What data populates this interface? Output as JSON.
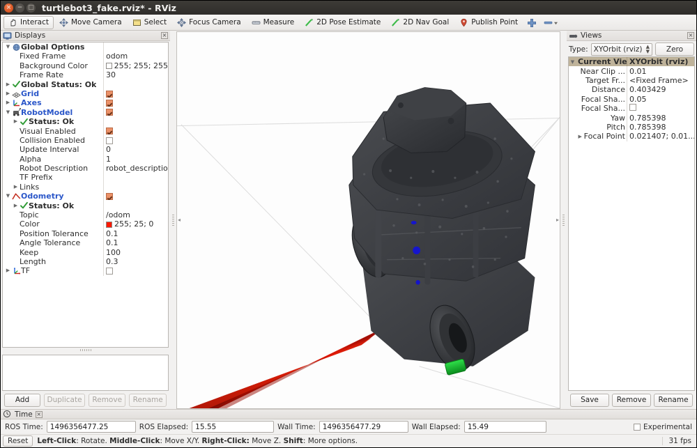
{
  "window": {
    "title": "turtlebot3_fake.rviz* - RViz",
    "buttons": {
      "close": "×",
      "minimize": "−",
      "maximize": "□"
    }
  },
  "toolbar": {
    "items": [
      {
        "label": "Interact",
        "icon": "hand-icon",
        "active": true
      },
      {
        "label": "Move Camera",
        "icon": "move-camera-icon",
        "active": false
      },
      {
        "label": "Select",
        "icon": "select-rect-icon",
        "active": false
      },
      {
        "label": "Focus Camera",
        "icon": "focus-camera-icon",
        "active": false
      },
      {
        "label": "Measure",
        "icon": "measure-icon",
        "active": false
      },
      {
        "label": "2D Pose Estimate",
        "icon": "pose-arrow-icon",
        "active": false
      },
      {
        "label": "2D Nav Goal",
        "icon": "nav-goal-icon",
        "active": false
      },
      {
        "label": "Publish Point",
        "icon": "map-pin-icon",
        "active": false
      }
    ],
    "add_tool_icon": "plus-icon",
    "remove_tool_icon": "minus-dropdown-icon"
  },
  "displays": {
    "panel_title": "Displays",
    "panel_icon": "monitor-icon",
    "close_label": "×",
    "rows": [
      {
        "indent": 0,
        "arrow": "open",
        "icon": "globe-icon",
        "label": "Global Options",
        "style": "bold",
        "value": "",
        "value_type": "text"
      },
      {
        "indent": 1,
        "arrow": "none",
        "icon": "none",
        "label": "Fixed Frame",
        "style": "plain",
        "value": "odom",
        "value_type": "text"
      },
      {
        "indent": 1,
        "arrow": "none",
        "icon": "none",
        "label": "Background Color",
        "style": "plain",
        "value": "255; 255; 255",
        "value_type": "color",
        "color": "#ffffff"
      },
      {
        "indent": 1,
        "arrow": "none",
        "icon": "none",
        "label": "Frame Rate",
        "style": "plain",
        "value": "30",
        "value_type": "text"
      },
      {
        "indent": 0,
        "arrow": "closed",
        "icon": "check-icon",
        "label": "Global Status: Ok",
        "style": "bold",
        "value": "",
        "value_type": "text"
      },
      {
        "indent": 0,
        "arrow": "closed",
        "icon": "grid-icon",
        "label": "Grid",
        "style": "blue",
        "value": "",
        "value_type": "checkbox",
        "checked": true
      },
      {
        "indent": 0,
        "arrow": "closed",
        "icon": "axes-icon",
        "label": "Axes",
        "style": "blue",
        "value": "",
        "value_type": "checkbox",
        "checked": true
      },
      {
        "indent": 0,
        "arrow": "open",
        "icon": "robot-icon",
        "label": "RobotModel",
        "style": "blue",
        "value": "",
        "value_type": "checkbox",
        "checked": true
      },
      {
        "indent": 1,
        "arrow": "closed",
        "icon": "check-icon",
        "label": "Status: Ok",
        "style": "bold",
        "value": "",
        "value_type": "text"
      },
      {
        "indent": 1,
        "arrow": "none",
        "icon": "none",
        "label": "Visual Enabled",
        "style": "plain",
        "value": "",
        "value_type": "checkbox",
        "checked": true
      },
      {
        "indent": 1,
        "arrow": "none",
        "icon": "none",
        "label": "Collision Enabled",
        "style": "plain",
        "value": "",
        "value_type": "checkbox",
        "checked": false
      },
      {
        "indent": 1,
        "arrow": "none",
        "icon": "none",
        "label": "Update Interval",
        "style": "plain",
        "value": "0",
        "value_type": "text"
      },
      {
        "indent": 1,
        "arrow": "none",
        "icon": "none",
        "label": "Alpha",
        "style": "plain",
        "value": "1",
        "value_type": "text"
      },
      {
        "indent": 1,
        "arrow": "none",
        "icon": "none",
        "label": "Robot Description",
        "style": "plain",
        "value": "robot_description",
        "value_type": "text"
      },
      {
        "indent": 1,
        "arrow": "none",
        "icon": "none",
        "label": "TF Prefix",
        "style": "plain",
        "value": "",
        "value_type": "text"
      },
      {
        "indent": 1,
        "arrow": "closed",
        "icon": "none",
        "label": "Links",
        "style": "plain",
        "value": "",
        "value_type": "text"
      },
      {
        "indent": 0,
        "arrow": "open",
        "icon": "odom-icon",
        "label": "Odometry",
        "style": "blue",
        "value": "",
        "value_type": "checkbox",
        "checked": true
      },
      {
        "indent": 1,
        "arrow": "closed",
        "icon": "check-icon",
        "label": "Status: Ok",
        "style": "bold",
        "value": "",
        "value_type": "text"
      },
      {
        "indent": 1,
        "arrow": "none",
        "icon": "none",
        "label": "Topic",
        "style": "plain",
        "value": "/odom",
        "value_type": "text"
      },
      {
        "indent": 1,
        "arrow": "none",
        "icon": "none",
        "label": "Color",
        "style": "plain",
        "value": "255; 25; 0",
        "value_type": "color",
        "color": "#ff1900"
      },
      {
        "indent": 1,
        "arrow": "none",
        "icon": "none",
        "label": "Position Tolerance",
        "style": "plain",
        "value": "0.1",
        "value_type": "text"
      },
      {
        "indent": 1,
        "arrow": "none",
        "icon": "none",
        "label": "Angle Tolerance",
        "style": "plain",
        "value": "0.1",
        "value_type": "text"
      },
      {
        "indent": 1,
        "arrow": "none",
        "icon": "none",
        "label": "Keep",
        "style": "plain",
        "value": "100",
        "value_type": "text"
      },
      {
        "indent": 1,
        "arrow": "none",
        "icon": "none",
        "label": "Length",
        "style": "plain",
        "value": "0.3",
        "value_type": "text"
      },
      {
        "indent": 0,
        "arrow": "closed",
        "icon": "tf-icon",
        "label": "TF",
        "style": "plain",
        "value": "",
        "value_type": "checkbox",
        "checked": false
      }
    ],
    "buttons": [
      {
        "label": "Add",
        "enabled": true
      },
      {
        "label": "Duplicate",
        "enabled": false
      },
      {
        "label": "Remove",
        "enabled": false
      },
      {
        "label": "Rename",
        "enabled": false
      }
    ]
  },
  "views": {
    "panel_title": "Views",
    "panel_icon": "views-icon",
    "close_label": "×",
    "type_label": "Type:",
    "type_value": "XYOrbit (rviz)",
    "zero_label": "Zero",
    "rows": [
      {
        "name": "Current View",
        "value": "XYOrbit (rviz)",
        "selected": true,
        "arrow": "open"
      },
      {
        "name": "Near Clip ...",
        "value": "0.01",
        "selected": false,
        "arrow": "none"
      },
      {
        "name": "Target Fr...",
        "value": "<Fixed Frame>",
        "selected": false,
        "arrow": "none"
      },
      {
        "name": "Distance",
        "value": "0.403429",
        "selected": false,
        "arrow": "none"
      },
      {
        "name": "Focal Sha...",
        "value": "0.05",
        "selected": false,
        "arrow": "none"
      },
      {
        "name": "Focal Sha...",
        "value": "",
        "selected": false,
        "arrow": "none",
        "value_type": "checkbox",
        "checked": false
      },
      {
        "name": "Yaw",
        "value": "0.785398",
        "selected": false,
        "arrow": "none"
      },
      {
        "name": "Pitch",
        "value": "0.785398",
        "selected": false,
        "arrow": "none"
      },
      {
        "name": "Focal Point",
        "value": "0.021407; 0.01...",
        "selected": false,
        "arrow": "closed"
      }
    ],
    "buttons": [
      {
        "label": "Save",
        "enabled": true
      },
      {
        "label": "Remove",
        "enabled": true
      },
      {
        "label": "Rename",
        "enabled": true
      }
    ]
  },
  "time": {
    "panel_title": "Time",
    "panel_icon": "clock-icon",
    "close_label": "×",
    "fields": [
      {
        "label": "ROS Time:",
        "value": "1496356477.25"
      },
      {
        "label": "ROS Elapsed:",
        "value": "15.55"
      },
      {
        "label": "Wall Time:",
        "value": "1496356477.29"
      },
      {
        "label": "Wall Elapsed:",
        "value": "15.49"
      }
    ],
    "experimental_label": "Experimental",
    "experimental_checked": false
  },
  "statusbar": {
    "reset_label": "Reset",
    "hint_parts": [
      {
        "text": "Left-Click",
        "bold": true
      },
      {
        "text": ": Rotate.  ",
        "bold": false
      },
      {
        "text": "Middle-Click",
        "bold": true
      },
      {
        "text": ": Move X/Y.  ",
        "bold": false
      },
      {
        "text": "Right-Click:",
        "bold": true
      },
      {
        "text": " Move Z.  ",
        "bold": false
      },
      {
        "text": "Shift",
        "bold": true
      },
      {
        "text": ": More options.",
        "bold": false
      }
    ],
    "hint_text": "Left-Click: Rotate. Middle-Click: Move X/Y. Right-Click:: Move Z. Shift: More options.",
    "fps": "31 fps"
  },
  "viewport": {
    "background_color": "#fdfdfd",
    "robot_model_color": "#3e4044",
    "odometry_arrow_color": "#c40a00",
    "axis_green_color": "#00bb22",
    "grid_line_color": "#d8d8d8"
  }
}
